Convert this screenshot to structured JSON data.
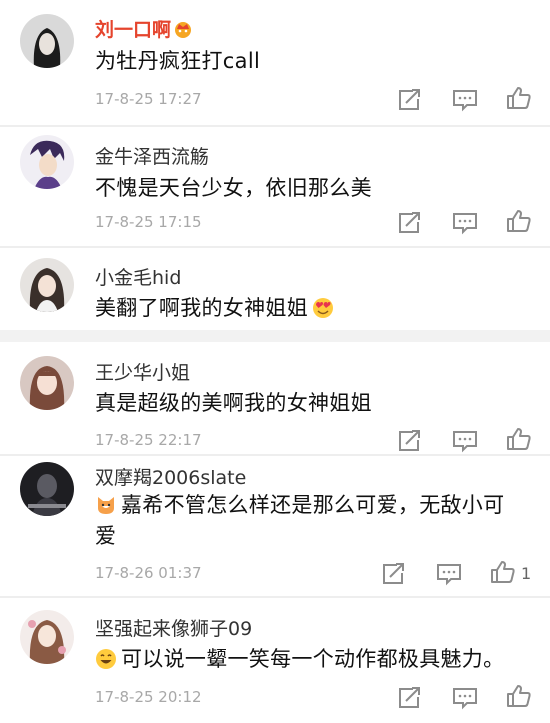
{
  "comments": [
    {
      "user": "刘一口啊",
      "text": "为牡丹疯狂打call",
      "time": "17-8-25 17:27"
    },
    {
      "user": "金牛泽西流觞",
      "text": "不愧是天台少女，依旧那么美",
      "time": "17-8-25 17:15"
    },
    {
      "user": "小金毛hid",
      "text": "美翻了啊我的女神姐姐"
    },
    {
      "user": "王少华小姐",
      "text": "真是超级的美啊我的女神姐姐",
      "time": "17-8-25 22:17"
    },
    {
      "user": "双摩羯2006slate",
      "text_line1": "嘉希不管怎么样还是那么可爱，无敌小可",
      "text_line2": "爱",
      "time": "17-8-26 01:37",
      "likes": "1"
    },
    {
      "user": "坚强起来像狮子09",
      "text": "可以说一颦一笑每一个动作都极具魅力。",
      "time": "17-8-25 20:12"
    }
  ],
  "icons": {
    "repost": "repost-icon",
    "comment": "comment-icon",
    "like": "like-icon",
    "vip": "vip-crown-icon"
  },
  "colors": {
    "vip_name": "#e5442d",
    "timestamp": "#a8a8a8",
    "icon": "#8c8c8c"
  }
}
